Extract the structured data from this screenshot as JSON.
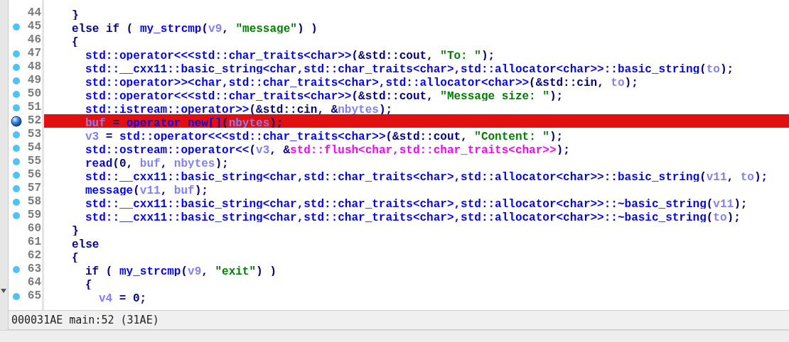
{
  "code_lines": [
    {
      "number": "44",
      "dot": false,
      "breakpoint": false,
      "highlighted": false,
      "tokens": [
        {
          "kind": "plain",
          "text": "}"
        }
      ]
    },
    {
      "number": "45",
      "dot": true,
      "breakpoint": false,
      "highlighted": false,
      "tokens": [
        {
          "kind": "plain",
          "text": "else if ( "
        },
        {
          "kind": "func",
          "text": "my_strcmp"
        },
        {
          "kind": "plain",
          "text": "("
        },
        {
          "kind": "var",
          "text": "v9"
        },
        {
          "kind": "plain",
          "text": ", "
        },
        {
          "kind": "string",
          "text": "\"message\""
        },
        {
          "kind": "plain",
          "text": ") )"
        }
      ]
    },
    {
      "number": "46",
      "dot": false,
      "breakpoint": false,
      "highlighted": false,
      "tokens": [
        {
          "kind": "plain",
          "text": "{"
        }
      ],
      "children": [
        {
          "number": "47",
          "dot": true,
          "breakpoint": false,
          "highlighted": false,
          "tokens": [
            {
              "kind": "func",
              "text": "std::operator<<<std::char_traits<char>>"
            },
            {
              "kind": "plain",
              "text": "(&std::cout, "
            },
            {
              "kind": "string",
              "text": "\"To: \""
            },
            {
              "kind": "plain",
              "text": ");"
            }
          ]
        },
        {
          "number": "48",
          "dot": true,
          "breakpoint": false,
          "highlighted": false,
          "tokens": [
            {
              "kind": "func",
              "text": "std::__cxx11::basic_string<char,std::char_traits<char>,std::allocator<char>>::basic_string"
            },
            {
              "kind": "plain",
              "text": "("
            },
            {
              "kind": "var",
              "text": "to"
            },
            {
              "kind": "plain",
              "text": ");"
            }
          ]
        },
        {
          "number": "49",
          "dot": true,
          "breakpoint": false,
          "highlighted": false,
          "tokens": [
            {
              "kind": "func",
              "text": "std::operator>><char,std::char_traits<char>,std::allocator<char>>"
            },
            {
              "kind": "plain",
              "text": "(&std::cin, "
            },
            {
              "kind": "var",
              "text": "to"
            },
            {
              "kind": "plain",
              "text": ");"
            }
          ]
        },
        {
          "number": "50",
          "dot": true,
          "breakpoint": false,
          "highlighted": false,
          "tokens": [
            {
              "kind": "func",
              "text": "std::operator<<<std::char_traits<char>>"
            },
            {
              "kind": "plain",
              "text": "(&std::cout, "
            },
            {
              "kind": "string",
              "text": "\"Message size: \""
            },
            {
              "kind": "plain",
              "text": ");"
            }
          ]
        },
        {
          "number": "51",
          "dot": true,
          "breakpoint": false,
          "highlighted": false,
          "tokens": [
            {
              "kind": "func",
              "text": "std::istream::operator>>"
            },
            {
              "kind": "plain",
              "text": "(&std::cin, &"
            },
            {
              "kind": "var",
              "text": "nbytes"
            },
            {
              "kind": "plain",
              "text": ");"
            }
          ]
        },
        {
          "number": "52",
          "dot": false,
          "breakpoint": true,
          "highlighted": true,
          "tokens": [
            {
              "kind": "var",
              "text": "buf"
            },
            {
              "kind": "plain",
              "text": " = "
            },
            {
              "kind": "func",
              "text": "operator new[]"
            },
            {
              "kind": "plain",
              "text": "("
            },
            {
              "kind": "var",
              "text": "nbytes"
            },
            {
              "kind": "plain",
              "text": ");"
            }
          ]
        },
        {
          "number": "53",
          "dot": true,
          "breakpoint": false,
          "highlighted": false,
          "tokens": [
            {
              "kind": "var",
              "text": "v3"
            },
            {
              "kind": "plain",
              "text": " = "
            },
            {
              "kind": "func",
              "text": "std::operator<<<std::char_traits<char>>"
            },
            {
              "kind": "plain",
              "text": "(&std::cout, "
            },
            {
              "kind": "string",
              "text": "\"Content: \""
            },
            {
              "kind": "plain",
              "text": ");"
            }
          ]
        },
        {
          "number": "54",
          "dot": true,
          "breakpoint": false,
          "highlighted": false,
          "tokens": [
            {
              "kind": "func",
              "text": "std::ostream::operator<<"
            },
            {
              "kind": "plain",
              "text": "("
            },
            {
              "kind": "var",
              "text": "v3"
            },
            {
              "kind": "plain",
              "text": ", &"
            },
            {
              "kind": "library",
              "text": "std::flush<char,std::char_traits<char>>"
            },
            {
              "kind": "plain",
              "text": ");"
            }
          ]
        },
        {
          "number": "55",
          "dot": true,
          "breakpoint": false,
          "highlighted": false,
          "tokens": [
            {
              "kind": "func",
              "text": "read"
            },
            {
              "kind": "plain",
              "text": "(0, "
            },
            {
              "kind": "var",
              "text": "buf"
            },
            {
              "kind": "plain",
              "text": ", "
            },
            {
              "kind": "var",
              "text": "nbytes"
            },
            {
              "kind": "plain",
              "text": ");"
            }
          ]
        },
        {
          "number": "56",
          "dot": true,
          "breakpoint": false,
          "highlighted": false,
          "tokens": [
            {
              "kind": "func",
              "text": "std::__cxx11::basic_string<char,std::char_traits<char>,std::allocator<char>>::basic_string"
            },
            {
              "kind": "plain",
              "text": "("
            },
            {
              "kind": "var",
              "text": "v11"
            },
            {
              "kind": "plain",
              "text": ", "
            },
            {
              "kind": "var",
              "text": "to"
            },
            {
              "kind": "plain",
              "text": ");"
            }
          ]
        },
        {
          "number": "57",
          "dot": true,
          "breakpoint": false,
          "highlighted": false,
          "tokens": [
            {
              "kind": "func",
              "text": "message"
            },
            {
              "kind": "plain",
              "text": "("
            },
            {
              "kind": "var",
              "text": "v11"
            },
            {
              "kind": "plain",
              "text": ", "
            },
            {
              "kind": "var",
              "text": "buf"
            },
            {
              "kind": "plain",
              "text": ");"
            }
          ]
        },
        {
          "number": "58",
          "dot": true,
          "breakpoint": false,
          "highlighted": false,
          "tokens": [
            {
              "kind": "func",
              "text": "std::__cxx11::basic_string<char,std::char_traits<char>,std::allocator<char>>::~basic_string"
            },
            {
              "kind": "plain",
              "text": "("
            },
            {
              "kind": "var",
              "text": "v11"
            },
            {
              "kind": "plain",
              "text": ");"
            }
          ]
        },
        {
          "number": "59",
          "dot": true,
          "breakpoint": false,
          "highlighted": false,
          "tokens": [
            {
              "kind": "func",
              "text": "std::__cxx11::basic_string<char,std::char_traits<char>,std::allocator<char>>::~basic_string"
            },
            {
              "kind": "plain",
              "text": "("
            },
            {
              "kind": "var",
              "text": "to"
            },
            {
              "kind": "plain",
              "text": ");"
            }
          ]
        }
      ]
    },
    {
      "number": "60",
      "dot": false,
      "breakpoint": false,
      "highlighted": false,
      "tokens": [
        {
          "kind": "plain",
          "text": "}"
        }
      ]
    },
    {
      "number": "61",
      "dot": false,
      "breakpoint": false,
      "highlighted": false,
      "tokens": [
        {
          "kind": "plain",
          "text": "else"
        }
      ]
    },
    {
      "number": "62",
      "dot": false,
      "breakpoint": false,
      "highlighted": false,
      "tokens": [
        {
          "kind": "plain",
          "text": "{"
        }
      ],
      "children": [
        {
          "number": "63",
          "dot": true,
          "breakpoint": false,
          "highlighted": false,
          "tokens": [
            {
              "kind": "plain",
              "text": "if ( "
            },
            {
              "kind": "func",
              "text": "my_strcmp"
            },
            {
              "kind": "plain",
              "text": "("
            },
            {
              "kind": "var",
              "text": "v9"
            },
            {
              "kind": "plain",
              "text": ", "
            },
            {
              "kind": "string",
              "text": "\"exit\""
            },
            {
              "kind": "plain",
              "text": ") )"
            }
          ]
        },
        {
          "number": "64",
          "dot": false,
          "breakpoint": false,
          "highlighted": false,
          "tokens": [
            {
              "kind": "plain",
              "text": "{"
            }
          ],
          "children": [
            {
              "number": "65",
              "dot": true,
              "breakpoint": false,
              "highlighted": false,
              "tokens": [
                {
                  "kind": "var",
                  "text": "v4"
                },
                {
                  "kind": "plain",
                  "text": " = 0;"
                }
              ]
            }
          ]
        }
      ]
    }
  ],
  "status_bar": {
    "text": "000031AE main:52 (31AE)"
  }
}
